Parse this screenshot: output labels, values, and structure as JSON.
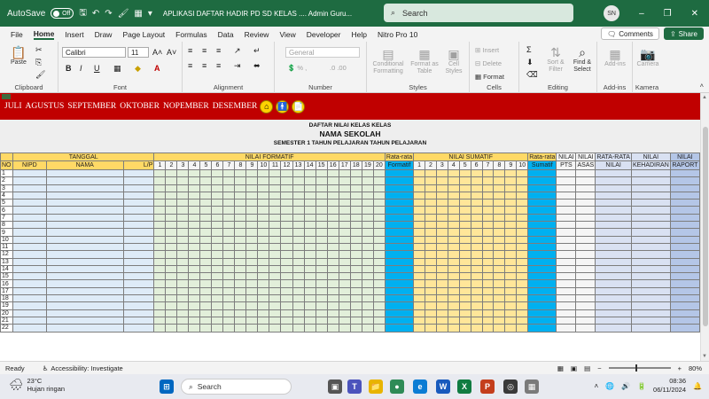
{
  "titlebar": {
    "autosave_label": "AutoSave",
    "autosave_state": "Off",
    "doc_title": "APLIKASI DAFTAR HADIR PD SD KELAS ....  Admin Guru...",
    "search_placeholder": "Search",
    "user_initials": "SN"
  },
  "menu": {
    "tabs": [
      "File",
      "Home",
      "Insert",
      "Draw",
      "Page Layout",
      "Formulas",
      "Data",
      "Review",
      "View",
      "Developer",
      "Help",
      "Nitro Pro 10"
    ],
    "comments_label": "Comments",
    "share_label": "Share"
  },
  "ribbon": {
    "clipboard": {
      "label": "Clipboard",
      "paste": "Paste"
    },
    "font": {
      "label": "Font",
      "name": "Calibri",
      "size": "11",
      "bold": "B",
      "italic": "I",
      "underline": "U"
    },
    "alignment": {
      "label": "Alignment"
    },
    "number": {
      "label": "Number",
      "format": "General"
    },
    "styles": {
      "label": "Styles",
      "conditional": "Conditional Formatting",
      "format_table": "Format as Table",
      "cell_styles": "Cell Styles"
    },
    "cells": {
      "label": "Cells",
      "insert": "Insert",
      "delete": "Delete",
      "format": "Format"
    },
    "editing": {
      "label": "Editing",
      "sort": "Sort & Filter",
      "find": "Find & Select"
    },
    "addins": {
      "label": "Add-ins",
      "btn": "Add-ins"
    },
    "kamera": {
      "label": "Kamera",
      "btn": "Camera"
    }
  },
  "sheet": {
    "months": [
      "JULI",
      "AGUSTUS",
      "SEPTEMBER",
      "OKTOBER",
      "NOPEMBER",
      "DESEMBER"
    ],
    "title1": "DAFTAR NILAI KELAS KELAS",
    "title2": "NAMA SEKOLAH",
    "title3": "SEMESTER 1 TAHUN PELAJARAN TAHUN PELAJARAN",
    "headers": {
      "tanggal": "TANGGAL",
      "no": "NO",
      "nipd": "NIPD",
      "nama": "NAMA",
      "lp": "L/P",
      "nilai_formatif": "NILAI FORMATIF",
      "rata_formatif_top": "Rata-rata",
      "rata_formatif_bottom": "Formatif",
      "nilai_sumatif": "NILAI SUMATIF",
      "rata_sumatif_top": "Rata-rata",
      "rata_sumatif_bottom": "Sumatif",
      "pts_top": "NILAI",
      "pts_bottom": "PTS",
      "asas_top": "NILAI",
      "asas_bottom": "ASAS",
      "rr_top": "RATA-RATA",
      "rr_bottom": "NILAI",
      "keh_top": "NILAI",
      "keh_bottom": "KEHADIRAN",
      "rap_top": "NILAI",
      "rap_bottom": "RAPORT"
    },
    "formatif_count": 20,
    "sumatif_count": 10,
    "rows": 22
  },
  "statusbar": {
    "ready": "Ready",
    "accessibility": "Accessibility: Investigate",
    "zoom": "80%"
  },
  "taskbar": {
    "temp": "23°C",
    "weather": "Hujan ringan",
    "search": "Search",
    "time": "08:36",
    "date": "06/11/2024"
  },
  "colors": {
    "excel_green": "#1e6b41",
    "nav_red": "#c00000",
    "header_yellow": "#ffd966",
    "average_cyan": "#00b0f0"
  }
}
